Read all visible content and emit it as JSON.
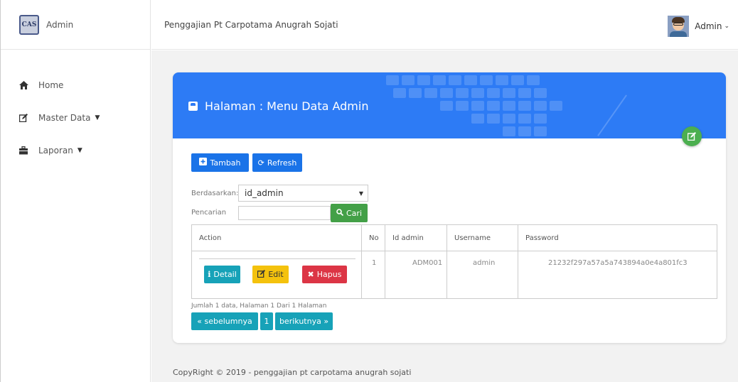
{
  "sidebar": {
    "brand_logo": "CAS",
    "brand_name": "Admin",
    "items": [
      {
        "label": "Home",
        "icon": "home-icon",
        "has_chevron": false
      },
      {
        "label": "Master Data",
        "icon": "edit-icon",
        "has_chevron": true
      },
      {
        "label": "Laporan",
        "icon": "briefcase-icon",
        "has_chevron": true
      }
    ]
  },
  "header": {
    "title": "Penggajian Pt Carpotama Anugrah Sojati",
    "user_name": "Admin"
  },
  "card": {
    "title": "Halaman : Menu Data Admin",
    "header_color": "#2d7bf5",
    "buttons": {
      "tambah": "Tambah",
      "refresh": "Refresh"
    },
    "filter": {
      "by_label": "Berdasarkan:",
      "by_value": "id_admin",
      "search_label": "Pencarian",
      "search_value": "",
      "search_button": "Cari"
    },
    "table": {
      "columns": [
        "Action",
        "No",
        "Id admin",
        "Username",
        "Password"
      ],
      "rows": [
        {
          "no": "1",
          "id_admin": "ADM001",
          "username": "admin",
          "password": "21232f297a57a5a743894a0e4a801fc3"
        }
      ],
      "actions": {
        "detail": "Detail",
        "edit": "Edit",
        "hapus": "Hapus"
      }
    },
    "paging_info": "Jumlah 1 data, Halaman 1 Dari 1 Halaman",
    "pager": {
      "prev": "« sebelumnya",
      "current": "1",
      "next": "berikutnya »"
    }
  },
  "footer": "CopyRight © 2019 - penggajian pt carpotama anugrah sojati",
  "colors": {
    "primary": "#1a73e8",
    "success": "#43a047",
    "info": "#17a2b8",
    "warning": "#f4c20d",
    "danger": "#dc3545"
  }
}
